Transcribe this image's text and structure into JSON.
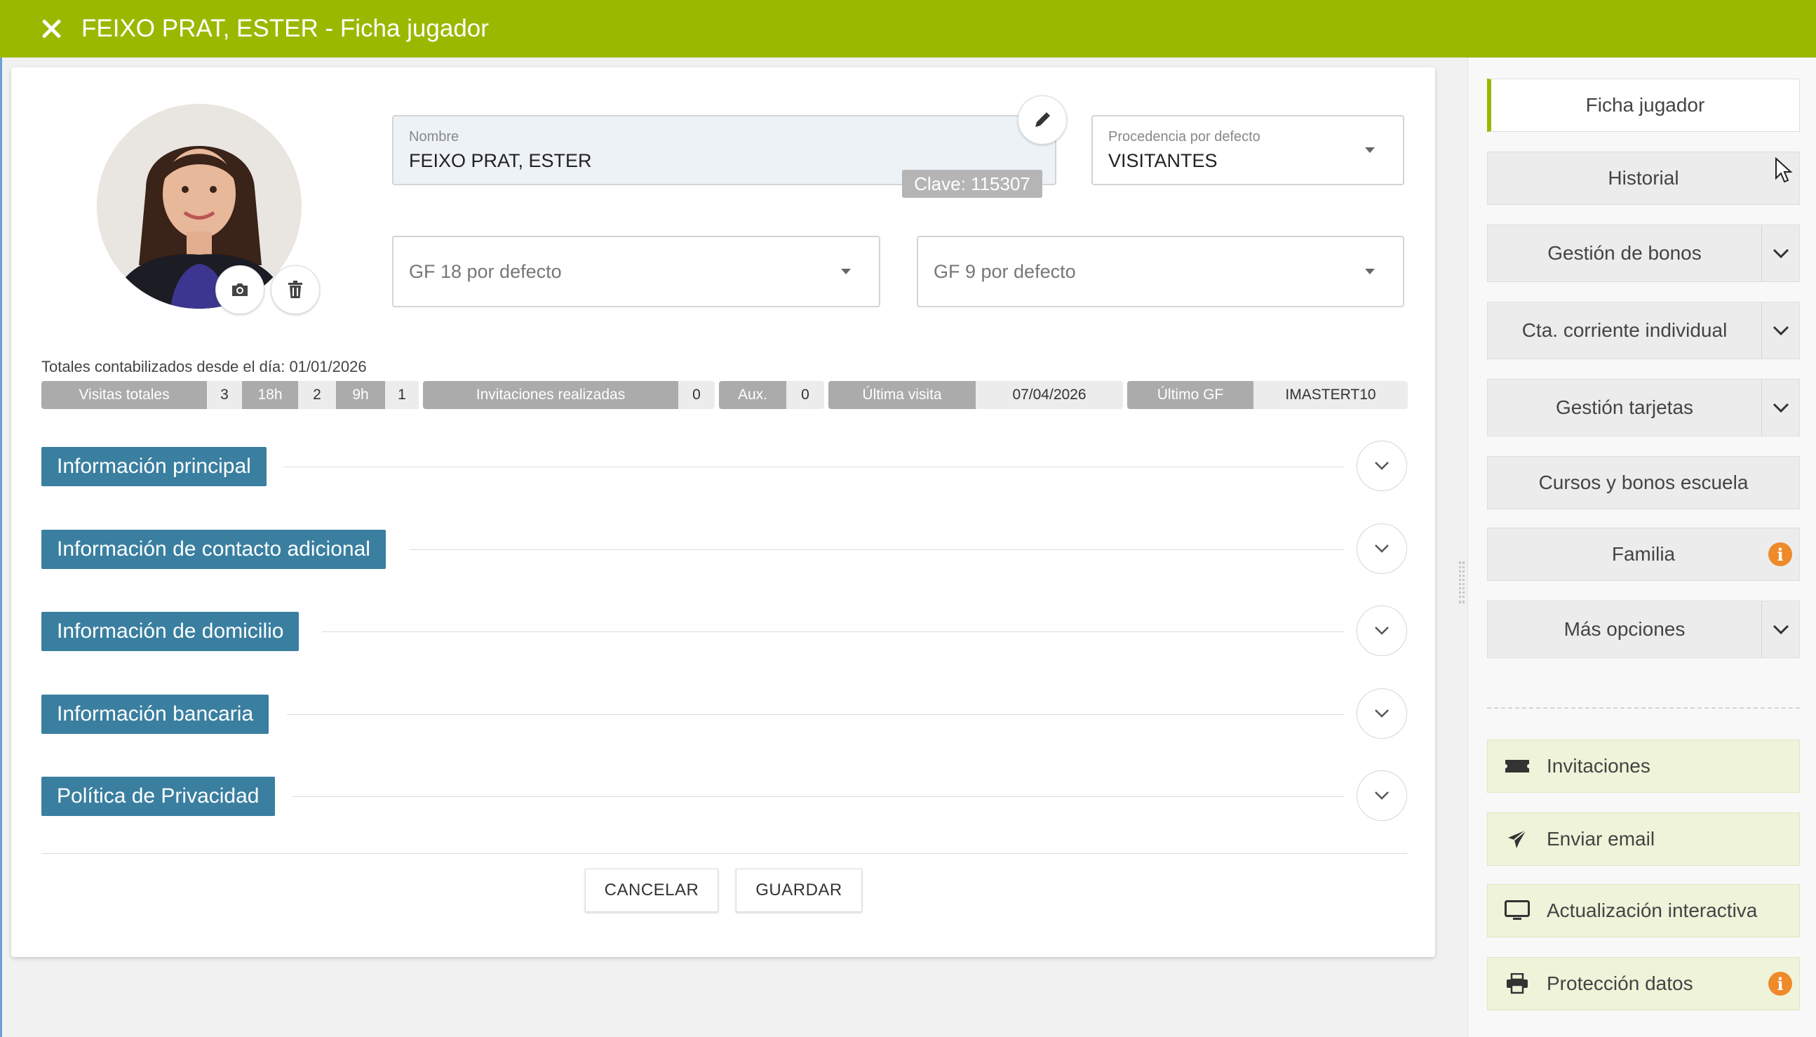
{
  "titlebar": {
    "title": "FEIXO PRAT, ESTER - Ficha jugador"
  },
  "player": {
    "nombre_label": "Nombre",
    "nombre_value": "FEIXO PRAT, ESTER",
    "clave": "Clave: 115307",
    "procedencia_label": "Procedencia por defecto",
    "procedencia_value": "VISITANTES",
    "gf18_placeholder": "GF 18 por defecto",
    "gf9_placeholder": "GF 9 por defecto"
  },
  "totals": {
    "label": "Totales contabilizados desde el día: 01/01/2026",
    "visitas_label": "Visitas totales",
    "visitas_value": "3",
    "h18_label": "18h",
    "h18_value": "2",
    "h9_label": "9h",
    "h9_value": "1",
    "invitaciones_label": "Invitaciones realizadas",
    "invitaciones_value": "0",
    "aux_label": "Aux.",
    "aux_value": "0",
    "ultima_visita_label": "Última visita",
    "ultima_visita_value": "07/04/2026",
    "ultimo_gf_label": "Último GF",
    "ultimo_gf_value": "IMASTERT10"
  },
  "sections": [
    "Información principal",
    "Información de contacto adicional",
    "Información de domicilio",
    "Información bancaria",
    "Política de Privacidad"
  ],
  "buttons": {
    "cancel": "CANCELAR",
    "save": "GUARDAR"
  },
  "sidebar": {
    "ficha": "Ficha jugador",
    "historial": "Historial",
    "bonos": "Gestión de bonos",
    "cta": "Cta. corriente individual",
    "tarjetas": "Gestión tarjetas",
    "cursos": "Cursos y bonos escuela",
    "familia": "Familia",
    "mas": "Más opciones",
    "info_badge": "i"
  },
  "actions": {
    "invitaciones": "Invitaciones",
    "email": "Enviar email",
    "actualizacion": "Actualización interactiva",
    "proteccion": "Protección datos"
  },
  "colors": {
    "titlebar": "#9bb800",
    "section_tag": "#3a7fa0",
    "info_badge": "#ee8a2a",
    "action_bg": "#eef3d9"
  }
}
